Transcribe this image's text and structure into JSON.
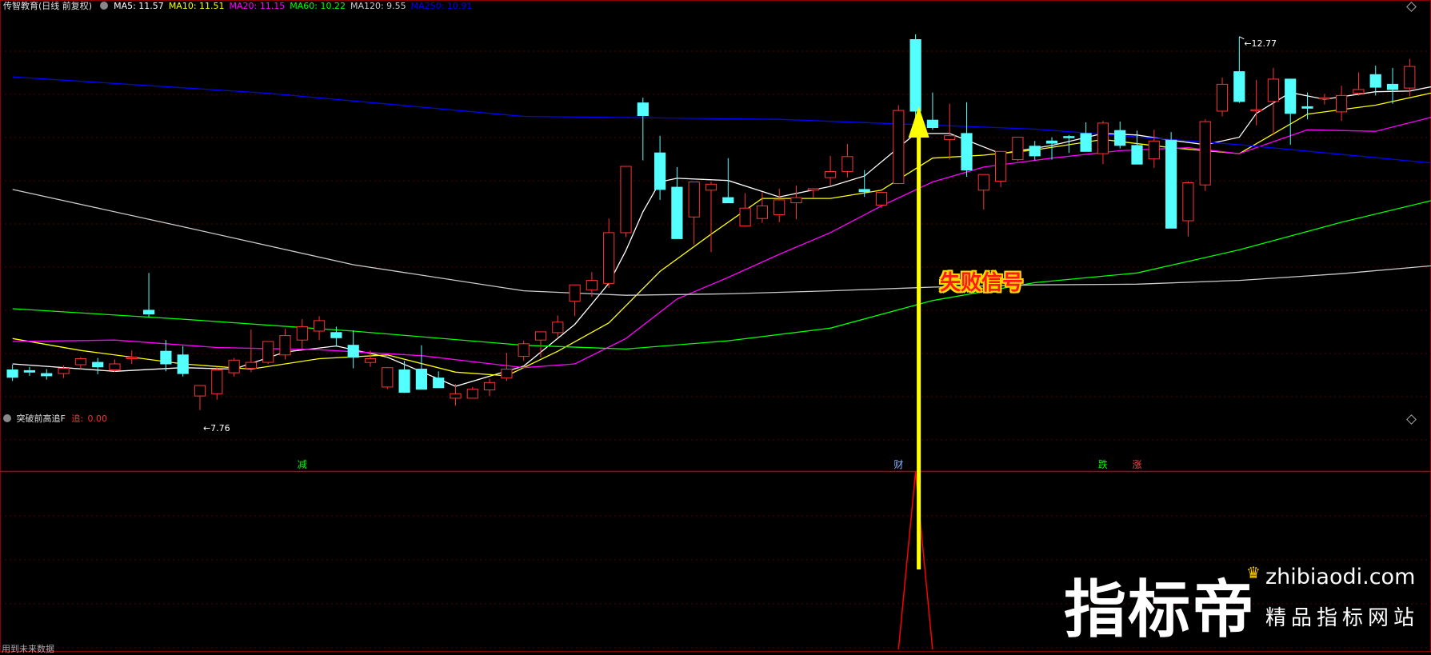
{
  "header": {
    "stock_title": "传智教育(日线 前复权)",
    "ma_items": [
      {
        "label": "MA5: 11.57",
        "color": "#ffffff"
      },
      {
        "label": "MA10: 11.51",
        "color": "#ffff00"
      },
      {
        "label": "MA20: 11.15",
        "color": "#ff00ff"
      },
      {
        "label": "MA60: 10.22",
        "color": "#00ff00"
      },
      {
        "label": "MA120: 9.55",
        "color": "#cccccc"
      },
      {
        "label": "MA250: 10.91",
        "color": "#0000ff"
      }
    ]
  },
  "chart_data": [
    {
      "type": "candlestick",
      "panel": "main",
      "ylim": [
        7.2,
        13.1
      ],
      "price_markers": {
        "high": "12.77",
        "low": "7.76"
      },
      "candles": [
        [
          8.3,
          8.37,
          8.15,
          8.2
        ],
        [
          8.29,
          8.34,
          8.22,
          8.27
        ],
        [
          8.25,
          8.31,
          8.17,
          8.22
        ],
        [
          8.25,
          8.36,
          8.19,
          8.32
        ],
        [
          8.37,
          8.47,
          8.31,
          8.45
        ],
        [
          8.4,
          8.46,
          8.24,
          8.34
        ],
        [
          8.3,
          8.44,
          8.27,
          8.38
        ],
        [
          8.45,
          8.56,
          8.38,
          8.47
        ],
        [
          9.1,
          9.6,
          9.0,
          9.05
        ],
        [
          8.55,
          8.7,
          8.28,
          8.38
        ],
        [
          8.5,
          8.62,
          8.21,
          8.25
        ],
        [
          7.95,
          8.05,
          7.76,
          8.09
        ],
        [
          7.98,
          8.34,
          7.9,
          8.3
        ],
        [
          8.26,
          8.46,
          8.21,
          8.43
        ],
        [
          8.32,
          8.84,
          8.27,
          8.4
        ],
        [
          8.4,
          8.55,
          8.38,
          8.68
        ],
        [
          8.5,
          8.85,
          8.44,
          8.76
        ],
        [
          8.7,
          8.98,
          8.58,
          8.88
        ],
        [
          8.82,
          9.02,
          8.7,
          8.96
        ],
        [
          8.8,
          8.88,
          8.61,
          8.73
        ],
        [
          8.63,
          8.83,
          8.32,
          8.47
        ],
        [
          8.4,
          8.56,
          8.34,
          8.45
        ],
        [
          8.07,
          8.34,
          8.04,
          8.33
        ],
        [
          8.3,
          8.42,
          7.99,
          8.0
        ],
        [
          8.31,
          8.63,
          8.25,
          8.04
        ],
        [
          8.19,
          8.28,
          8.06,
          8.06
        ],
        [
          7.92,
          8.11,
          7.82,
          7.98
        ],
        [
          7.92,
          8.07,
          7.96,
          8.04
        ],
        [
          8.03,
          8.18,
          7.95,
          8.13
        ],
        [
          8.19,
          8.53,
          8.15,
          8.31
        ],
        [
          8.48,
          8.69,
          8.42,
          8.65
        ],
        [
          8.7,
          8.77,
          8.47,
          8.81
        ],
        [
          8.8,
          9.03,
          8.74,
          8.94
        ],
        [
          9.22,
          9.38,
          9.02,
          9.44
        ],
        [
          9.37,
          9.61,
          9.28,
          9.5
        ],
        [
          9.46,
          10.33,
          9.4,
          10.14
        ],
        [
          10.14,
          11.0,
          10.08,
          11.03
        ],
        [
          11.88,
          11.95,
          11.11,
          11.71
        ],
        [
          11.21,
          11.44,
          10.58,
          10.72
        ],
        [
          10.75,
          11.02,
          10.06,
          10.06
        ],
        [
          10.35,
          10.81,
          9.98,
          10.82
        ],
        [
          10.71,
          10.82,
          9.88,
          10.79
        ],
        [
          10.61,
          11.14,
          10.58,
          10.54
        ],
        [
          10.23,
          10.67,
          10.24,
          10.47
        ],
        [
          10.33,
          10.68,
          10.27,
          10.5
        ],
        [
          10.38,
          10.73,
          10.28,
          10.58
        ],
        [
          10.54,
          10.77,
          10.32,
          10.61
        ],
        [
          10.71,
          10.73,
          10.61,
          10.73
        ],
        [
          10.88,
          11.17,
          10.77,
          10.96
        ],
        [
          10.96,
          11.33,
          10.88,
          11.16
        ],
        [
          10.72,
          10.98,
          10.62,
          10.69
        ],
        [
          10.51,
          10.69,
          10.47,
          10.68
        ],
        [
          10.8,
          11.85,
          10.79,
          11.78
        ],
        [
          12.73,
          12.8,
          11.47,
          11.77
        ],
        [
          11.65,
          12.02,
          11.52,
          11.55
        ],
        [
          11.39,
          11.87,
          11.12,
          11.44
        ],
        [
          11.47,
          11.89,
          10.89,
          10.98
        ],
        [
          10.71,
          10.89,
          10.45,
          10.92
        ],
        [
          10.83,
          11.0,
          10.75,
          11.23
        ],
        [
          11.12,
          11.38,
          11.1,
          11.42
        ],
        [
          11.3,
          11.37,
          11.11,
          11.17
        ],
        [
          11.37,
          11.42,
          11.12,
          11.34
        ],
        [
          11.43,
          11.45,
          11.21,
          11.42
        ],
        [
          11.47,
          11.62,
          11.25,
          11.23
        ],
        [
          11.2,
          11.64,
          11.06,
          11.61
        ],
        [
          11.51,
          11.63,
          11.27,
          11.31
        ],
        [
          11.31,
          11.51,
          11.09,
          11.06
        ],
        [
          11.13,
          11.52,
          11.01,
          11.37
        ],
        [
          11.38,
          11.49,
          10.2,
          10.2
        ],
        [
          10.3,
          10.83,
          10.09,
          10.81
        ],
        [
          10.78,
          11.66,
          10.7,
          11.63
        ],
        [
          11.77,
          12.22,
          11.7,
          12.13
        ],
        [
          12.3,
          12.77,
          11.88,
          11.9
        ],
        [
          11.78,
          12.19,
          11.58,
          11.79
        ],
        [
          11.9,
          12.35,
          11.45,
          12.2
        ],
        [
          12.2,
          12.03,
          11.32,
          11.74
        ],
        [
          11.83,
          12.02,
          11.66,
          11.81
        ],
        [
          11.95,
          12.0,
          11.86,
          11.95
        ],
        [
          11.76,
          12.11,
          11.64,
          11.98
        ],
        [
          12.01,
          12.29,
          11.98,
          12.06
        ],
        [
          12.26,
          12.38,
          11.98,
          12.09
        ],
        [
          12.13,
          12.35,
          11.87,
          12.06
        ],
        [
          12.08,
          12.47,
          11.97,
          12.37
        ]
      ],
      "series": [
        {
          "name": "MA5",
          "color": "#ffffff",
          "values": [
            [
              0,
              8.38
            ],
            [
              6,
              8.28
            ],
            [
              10,
              8.33
            ],
            [
              13,
              8.31
            ],
            [
              16,
              8.54
            ],
            [
              19,
              8.62
            ],
            [
              22,
              8.47
            ],
            [
              26,
              8.08
            ],
            [
              30,
              8.35
            ],
            [
              33,
              8.91
            ],
            [
              35,
              9.46
            ],
            [
              36,
              9.9
            ],
            [
              37,
              10.42
            ],
            [
              38,
              10.82
            ],
            [
              39,
              10.87
            ],
            [
              42,
              10.84
            ],
            [
              45,
              10.62
            ],
            [
              48,
              10.76
            ],
            [
              50,
              10.9
            ],
            [
              53,
              11.47
            ],
            [
              55,
              11.47
            ],
            [
              58,
              11.2
            ],
            [
              61,
              11.31
            ],
            [
              64,
              11.47
            ],
            [
              66,
              11.45
            ],
            [
              68,
              11.38
            ],
            [
              70,
              11.32
            ],
            [
              72,
              11.42
            ],
            [
              73,
              11.74
            ],
            [
              75,
              12.02
            ],
            [
              77,
              11.93
            ],
            [
              80,
              12.03
            ],
            [
              82,
              12.04
            ],
            [
              84,
              12.13
            ]
          ]
        },
        {
          "name": "MA10",
          "color": "#ffff00",
          "values": [
            [
              0,
              8.72
            ],
            [
              4,
              8.56
            ],
            [
              10,
              8.38
            ],
            [
              14,
              8.31
            ],
            [
              18,
              8.45
            ],
            [
              22,
              8.5
            ],
            [
              26,
              8.27
            ],
            [
              29,
              8.22
            ],
            [
              32,
              8.55
            ],
            [
              35,
              8.93
            ],
            [
              38,
              9.62
            ],
            [
              41,
              10.12
            ],
            [
              44,
              10.6
            ],
            [
              48,
              10.6
            ],
            [
              51,
              10.71
            ],
            [
              54,
              11.14
            ],
            [
              57,
              11.18
            ],
            [
              60,
              11.25
            ],
            [
              64,
              11.39
            ],
            [
              68,
              11.28
            ],
            [
              72,
              11.2
            ],
            [
              76,
              11.73
            ],
            [
              80,
              11.85
            ],
            [
              84,
              12.05
            ]
          ]
        },
        {
          "name": "MA20",
          "color": "#ff00ff",
          "values": [
            [
              0,
              8.68
            ],
            [
              6,
              8.7
            ],
            [
              12,
              8.6
            ],
            [
              18,
              8.57
            ],
            [
              24,
              8.49
            ],
            [
              30,
              8.33
            ],
            [
              33,
              8.38
            ],
            [
              36,
              8.72
            ],
            [
              39,
              9.25
            ],
            [
              42,
              9.54
            ],
            [
              45,
              9.85
            ],
            [
              48,
              10.14
            ],
            [
              51,
              10.5
            ],
            [
              54,
              10.82
            ],
            [
              57,
              11.02
            ],
            [
              61,
              11.14
            ],
            [
              65,
              11.24
            ],
            [
              69,
              11.28
            ],
            [
              72,
              11.2
            ],
            [
              76,
              11.52
            ],
            [
              80,
              11.5
            ],
            [
              84,
              11.73
            ]
          ]
        },
        {
          "name": "MA60",
          "color": "#00ff00",
          "values": [
            [
              0,
              9.12
            ],
            [
              10,
              8.98
            ],
            [
              20,
              8.82
            ],
            [
              30,
              8.63
            ],
            [
              36,
              8.58
            ],
            [
              42,
              8.69
            ],
            [
              48,
              8.86
            ],
            [
              54,
              9.23
            ],
            [
              60,
              9.47
            ],
            [
              66,
              9.6
            ],
            [
              72,
              9.91
            ],
            [
              78,
              10.28
            ],
            [
              84,
              10.61
            ]
          ]
        },
        {
          "name": "MA120",
          "color": "#cccccc",
          "values": [
            [
              0,
              10.72
            ],
            [
              10,
              10.22
            ],
            [
              20,
              9.71
            ],
            [
              30,
              9.36
            ],
            [
              36,
              9.3
            ],
            [
              42,
              9.32
            ],
            [
              48,
              9.36
            ],
            [
              54,
              9.41
            ],
            [
              60,
              9.44
            ],
            [
              66,
              9.45
            ],
            [
              72,
              9.5
            ],
            [
              78,
              9.59
            ],
            [
              84,
              9.71
            ]
          ]
        },
        {
          "name": "MA250",
          "color": "#0000ff",
          "values": [
            [
              0,
              12.23
            ],
            [
              15,
              12.01
            ],
            [
              30,
              11.7
            ],
            [
              45,
              11.66
            ],
            [
              60,
              11.53
            ],
            [
              72,
              11.32
            ],
            [
              84,
              11.06
            ]
          ]
        }
      ]
    },
    {
      "type": "line",
      "panel": "indicator",
      "series": [
        {
          "name": "追",
          "color": "#ff0000",
          "values": [
            [
              52,
              0
            ],
            [
              53,
              1
            ],
            [
              54,
              0
            ]
          ]
        }
      ]
    }
  ],
  "signals": [
    {
      "text": "减",
      "color": "#00ff00",
      "x": 17
    },
    {
      "text": "财",
      "color": "#8ab4ff",
      "x": 52
    },
    {
      "text": "跌",
      "color": "#00ff00",
      "x": 64
    },
    {
      "text": "涨",
      "color": "#ff4444",
      "x": 66
    }
  ],
  "annotation": {
    "text": "失败信号",
    "color": "#ff1a1a",
    "outline": "#ffd700"
  },
  "indicator": {
    "title": "突破前高追F",
    "tag_label": "追:",
    "tag_value": "0.00",
    "tag_color": "#ff0000"
  },
  "footer": {
    "status_text": "用到未来数据"
  },
  "watermark": {
    "brand_cn": "指标帝",
    "domain": "zhibiaodi.com",
    "tagline": "精品指标网站"
  }
}
